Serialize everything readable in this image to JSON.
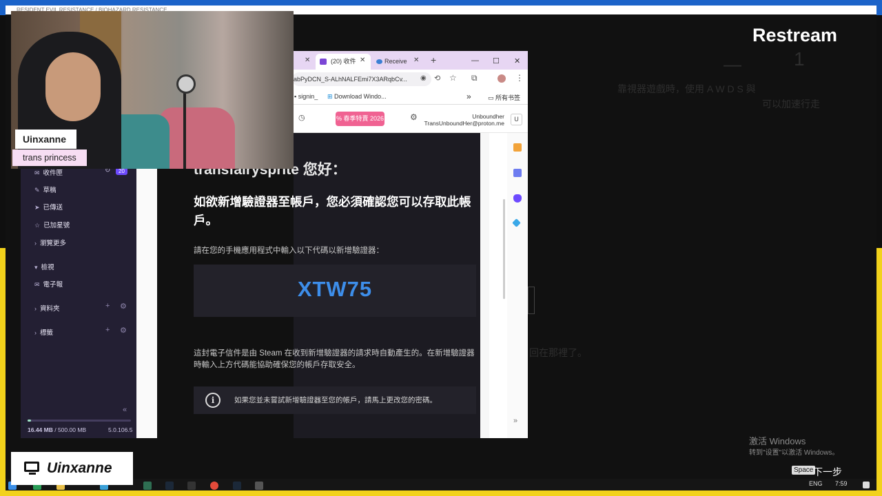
{
  "game": {
    "window_title": "RESIDENT EVIL RESISTANCE / BIOHAZARD RESISTANCE",
    "faint_text_1": "靠視器遊戲時，使用 A W D S 與",
    "faint_text_2": "可以加速行走",
    "faint_text_3": "回在那裡了。",
    "faint_dash": "—",
    "faint_num": "1",
    "activate_windows": "激活 Windows",
    "activate_windows_sub": "转到\"设置\"以激活 Windows。",
    "space_key": "Space",
    "next_step": "下一步"
  },
  "overlay": {
    "restream_logo": "Restream",
    "streamer_name": "Uinxanne",
    "streamer_tagline": "trans princess",
    "brand_name": "Uinxanne"
  },
  "browser": {
    "tabs": [
      {
        "label": "(20) 收件"
      },
      {
        "label": "Receive"
      }
    ],
    "new_tab": "+",
    "address": "abPyDCN_S-ALhNALFEmi7X3ARqbCv...",
    "bookmarks": [
      {
        "label": "signin_"
      },
      {
        "label": "Download Windo..."
      }
    ],
    "bookmarks_more": "»",
    "all_bookmarks": "所有书签",
    "promo_label": "春季特賣 2026",
    "user_name": "Unboundher",
    "user_email": "TransUnboundHer@proton.me",
    "user_badge": "U"
  },
  "sidebar": {
    "items": [
      {
        "glyph": "✉",
        "label": "收件匣",
        "count": "20"
      },
      {
        "glyph": "✎",
        "label": "草稿"
      },
      {
        "glyph": "➤",
        "label": "已傳送"
      },
      {
        "glyph": "☆",
        "label": "已加星號"
      },
      {
        "glyph": "›",
        "label": "瀏覽更多"
      },
      {
        "glyph": "▾",
        "label": "檢視"
      },
      {
        "glyph": "✉",
        "label": "電子報"
      },
      {
        "glyph": "›",
        "label": "資料夾"
      },
      {
        "glyph": "›",
        "label": "標籤"
      }
    ],
    "collapse": "«",
    "storage_used": "16.44 MB",
    "storage_total": "/ 500.00 MB",
    "version": "5.0.106.5"
  },
  "email": {
    "greeting": "transfairysprite 您好：",
    "heading": "如欲新增驗證器至帳戶，您必須確認您可以存取此帳戶。",
    "instruction": "請在您的手機應用程式中輸入以下代碼以新增驗證器：",
    "code": "XTW75",
    "paragraph": "這封電子信件是由 Steam 在收到新增驗證器的請求時自動產生的。在新增驗證器時輸入上方代碼能協助確保您的帳戶存取安全。",
    "notice": "如果您並未嘗試新增驗證器至您的帳戶，請馬上更改您的密碼。"
  },
  "taskbar": {
    "lang": "ENG",
    "time": "7:59"
  },
  "colors": {
    "accent_blue": "#3d8eea",
    "proton_sidebar": "#231f33",
    "promo_pink": "#f06292",
    "frame_yellow": "#f2d21b",
    "frame_blue": "#1b63c9"
  }
}
